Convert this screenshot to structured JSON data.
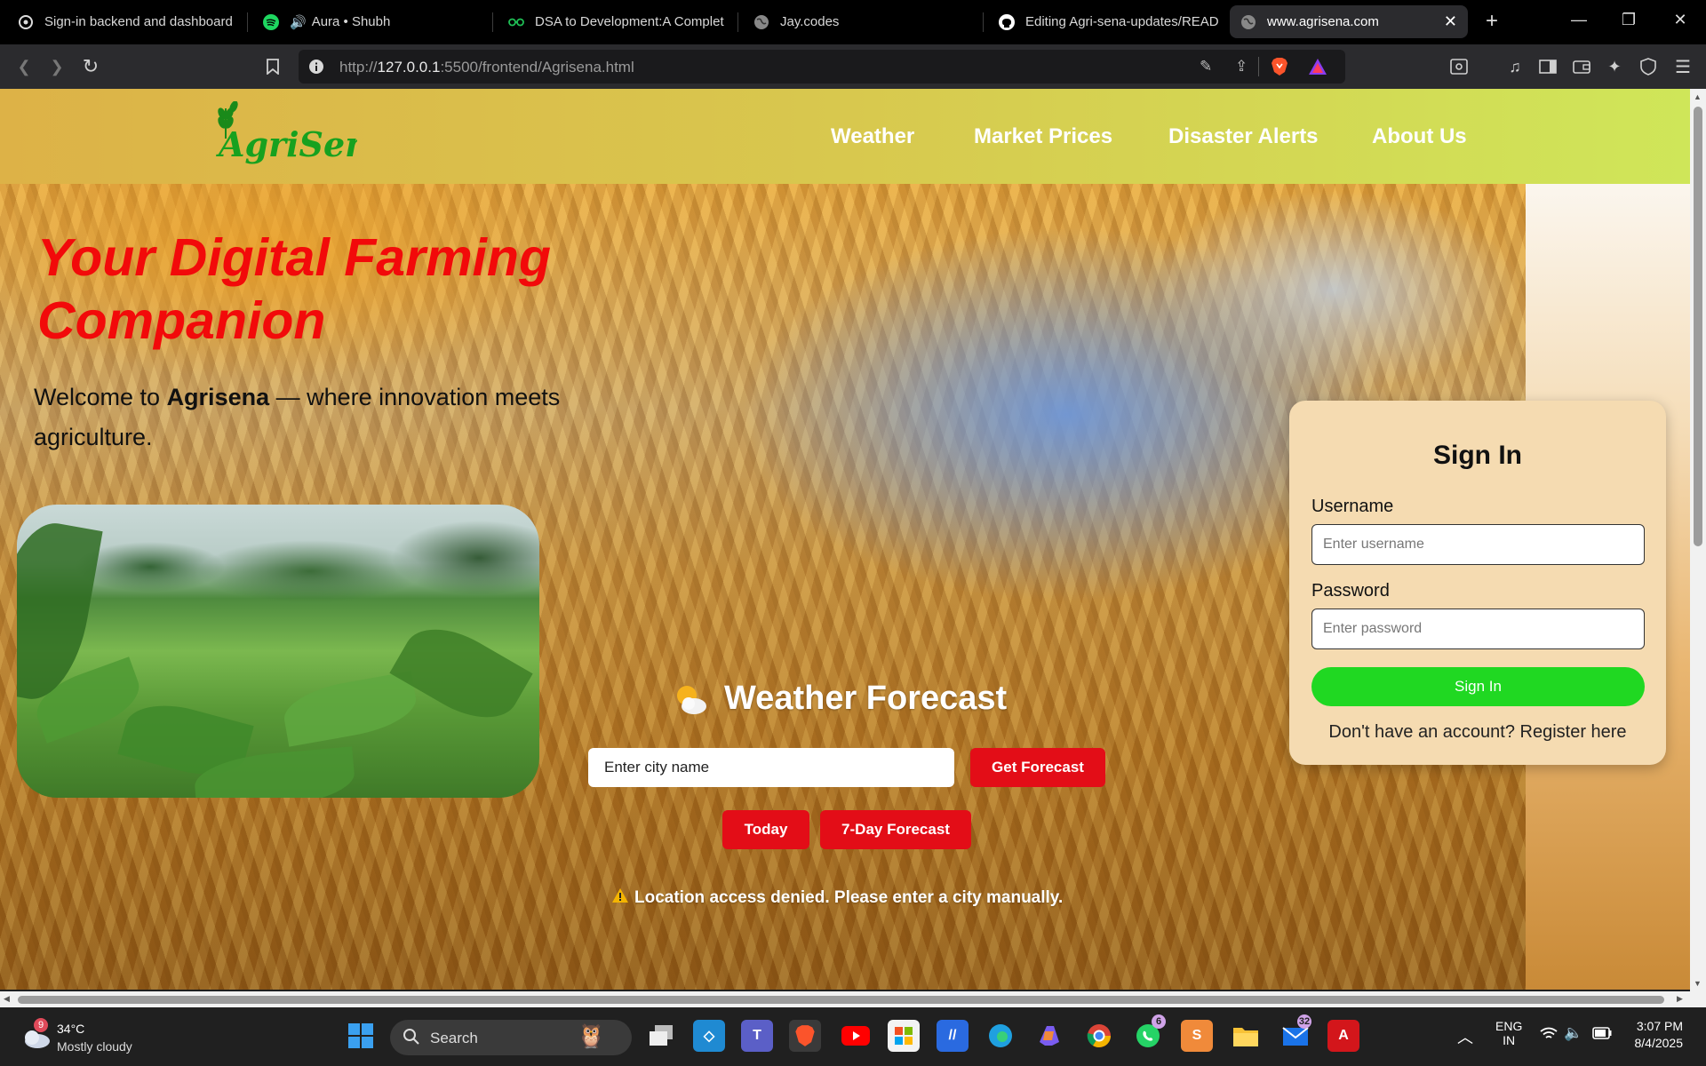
{
  "browser": {
    "tabs": [
      {
        "title": "Sign-in backend and dashboard",
        "icon": "openai-icon",
        "active": false
      },
      {
        "title": "Aura • Shubh",
        "icon": "spotify-icon",
        "active": false
      },
      {
        "title": "DSA to Development:A Complet",
        "icon": "glasses-icon",
        "active": false
      },
      {
        "title": "Jay.codes",
        "icon": "globe-icon",
        "active": false
      },
      {
        "title": "Editing Agri-sena-updates/READ",
        "icon": "github-icon",
        "active": false
      },
      {
        "title": "www.agrisena.com",
        "icon": "globe-icon",
        "active": true
      }
    ],
    "url_prefix": "http://",
    "url_host": "127.0.0.1",
    "url_rest": ":5500/frontend/Agrisena.html"
  },
  "site": {
    "logo_text": "AgriSena",
    "nav": [
      "Weather",
      "Market Prices",
      "Disaster Alerts",
      "About Us"
    ],
    "headline": "Your Digital Farming Companion",
    "welcome_prefix": "Welcome to ",
    "welcome_brand": "Agrisena",
    "welcome_suffix": " — where innovation meets agriculture."
  },
  "weather": {
    "title": "Weather Forecast",
    "city_placeholder": "Enter city name",
    "get_forecast": "Get Forecast",
    "today": "Today",
    "seven_day": "7-Day Forecast",
    "location_msg": "Location access denied. Please enter a city manually."
  },
  "signin": {
    "title": "Sign In",
    "username_label": "Username",
    "username_placeholder": "Enter username",
    "password_label": "Password",
    "password_placeholder": "Enter password",
    "button": "Sign In",
    "register": "Don't have an account? Register here"
  },
  "taskbar": {
    "weather_temp": "34°C",
    "weather_desc": "Mostly cloudy",
    "weather_badge": "9",
    "search_label": "Search",
    "whatsapp_badge": "6",
    "mail_badge": "32",
    "lang1": "ENG",
    "lang2": "IN",
    "time": "3:07 PM",
    "date": "8/4/2025"
  },
  "colors": {
    "accent_red": "#e30d17",
    "signin_green": "#20d822",
    "header_start": "#ddb247",
    "header_end": "#cfe659"
  }
}
